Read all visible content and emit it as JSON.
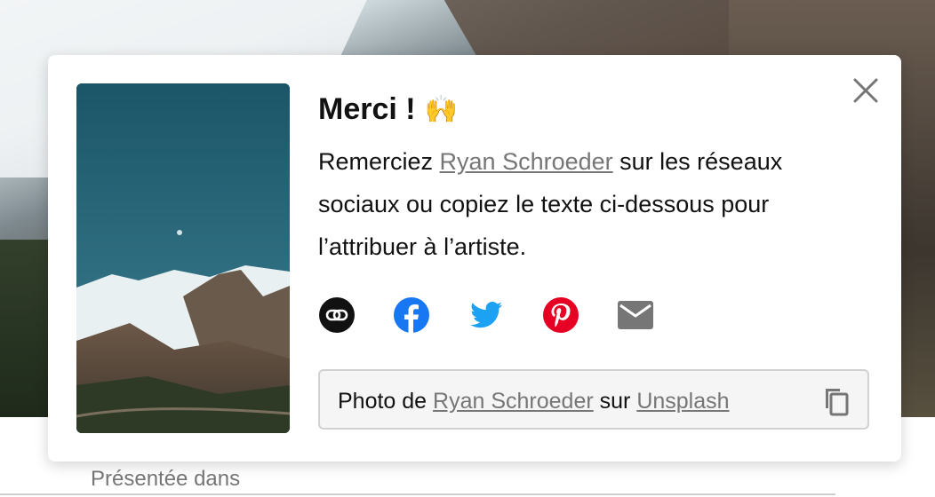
{
  "background": {
    "caption": "Présentée dans"
  },
  "modal": {
    "title": "Merci !",
    "title_emoji": "🙌",
    "description_prefix": "Remerciez ",
    "author_name": "Ryan Schroeder",
    "description_suffix": " sur les réseaux sociaux ou copiez le texte ci-dessous pour l’attribuer à l’artiste.",
    "share_buttons": [
      {
        "icon": "link-icon",
        "color": "#111111"
      },
      {
        "icon": "facebook-icon",
        "color": "#1877f2"
      },
      {
        "icon": "twitter-icon",
        "color": "#1da1f2"
      },
      {
        "icon": "pinterest-icon",
        "color": "#e60023"
      },
      {
        "icon": "email-icon",
        "color": "#767676"
      }
    ],
    "attribution": {
      "prefix": "Photo de ",
      "author": "Ryan Schroeder",
      "middle": " sur ",
      "site": "Unsplash"
    }
  }
}
